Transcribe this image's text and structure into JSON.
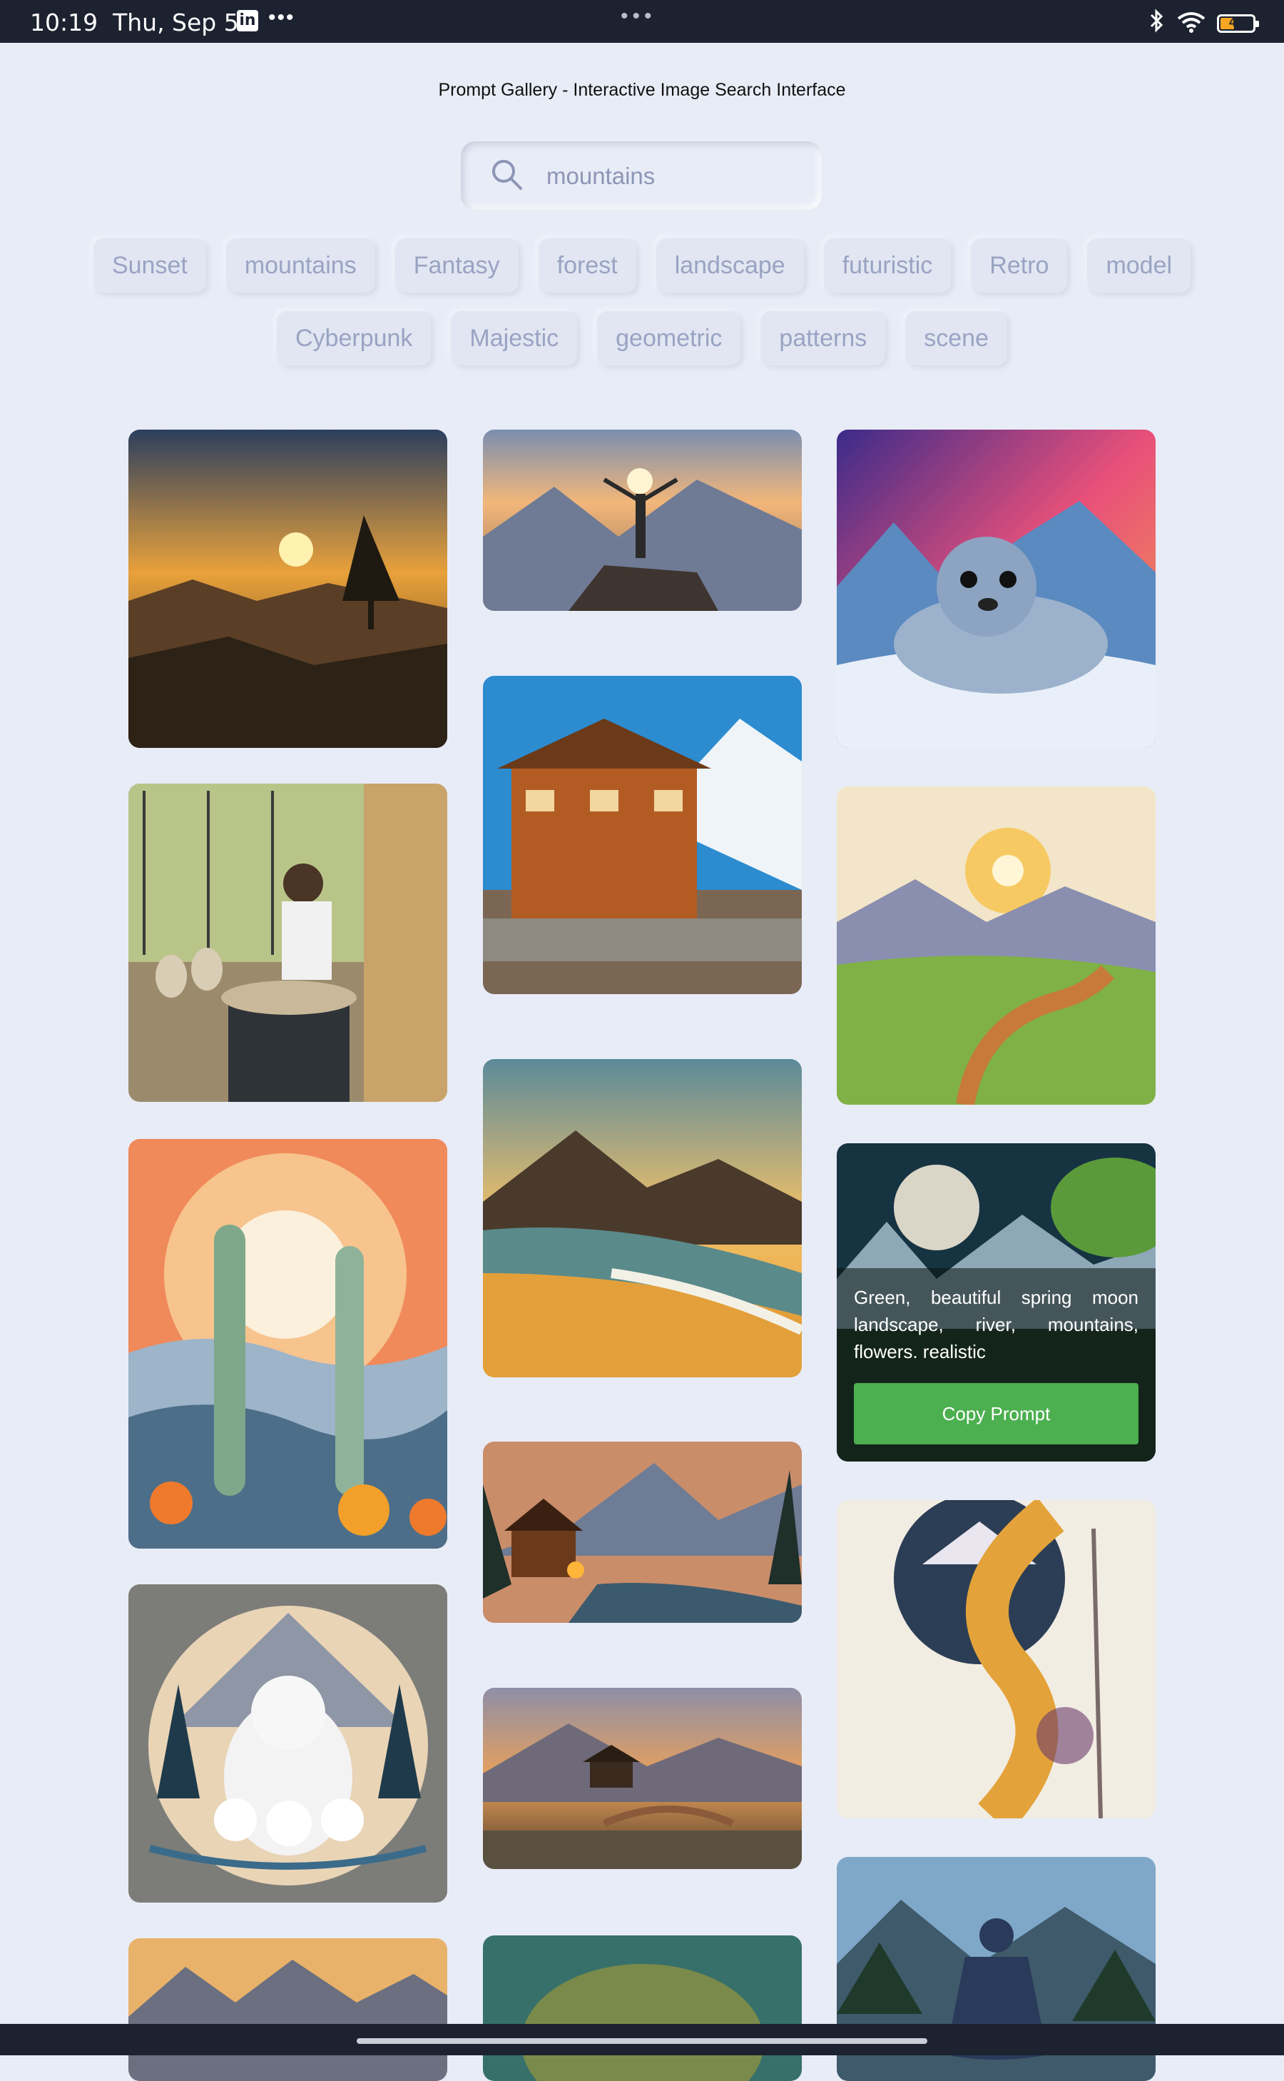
{
  "status_bar": {
    "time": "10:19",
    "date": "Thu, Sep 5",
    "linkedin_icon": "in",
    "overflow_dots": "•••",
    "center_dots": "•••",
    "battery_level": "43",
    "battery_fraction": 0.43
  },
  "page": {
    "title": "Prompt Gallery - Interactive Image Search Interface"
  },
  "search": {
    "value": "mountains",
    "placeholder": "Search"
  },
  "tags": {
    "row1": [
      "Sunset",
      "mountains",
      "Fantasy",
      "forest",
      "landscape",
      "futuristic",
      "Retro",
      "model"
    ],
    "row2": [
      "Cyberpunk",
      "Majestic",
      "geometric",
      "patterns",
      "scene"
    ]
  },
  "gallery": {
    "hover_card": {
      "prompt": "Green, beautiful spring moon landscape, river, mountains, flowers. realistic",
      "button_label": "Copy Prompt"
    }
  },
  "colors": {
    "background": "#e8ecf7",
    "accent_button": "#4caf50",
    "tag_text": "#9aa3c3",
    "status_bar": "#1c2230"
  }
}
